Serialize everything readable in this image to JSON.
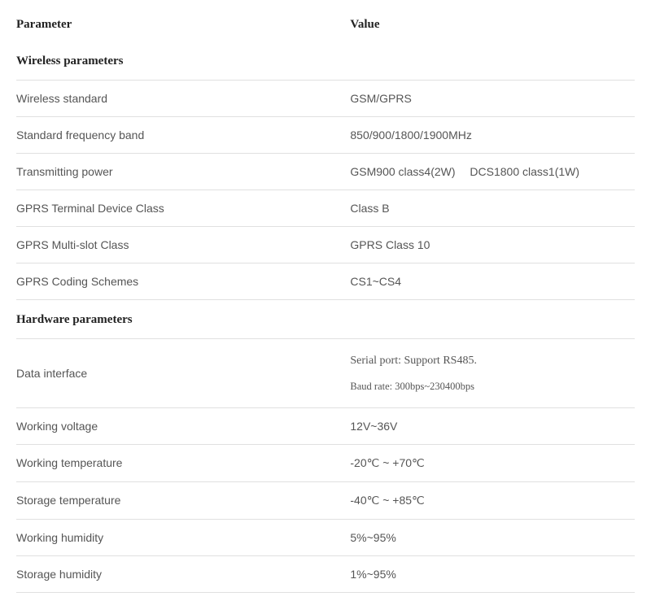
{
  "headers": {
    "parameter": "Parameter",
    "value": "Value"
  },
  "sections": {
    "wireless": "Wireless parameters",
    "hardware": "Hardware parameters"
  },
  "wireless": {
    "standard": {
      "label": "Wireless standard",
      "value": "GSM/GPRS"
    },
    "freq": {
      "label": "Standard frequency band",
      "value": "850/900/1800/1900MHz"
    },
    "txpower": {
      "label": "Transmitting power",
      "value": "GSM900 class4(2W)  DCS1800 class1(1W)"
    },
    "terminal": {
      "label": "GPRS Terminal Device Class",
      "value": "Class B"
    },
    "multislot": {
      "label": "GPRS Multi-slot Class",
      "value": "GPRS Class 10"
    },
    "coding": {
      "label": "GPRS Coding Schemes",
      "value": "CS1~CS4"
    }
  },
  "hardware": {
    "data_interface": {
      "label": "Data interface",
      "line1": "Serial port: Support RS485.",
      "line2": "Baud rate: 300bps~230400bps"
    },
    "voltage": {
      "label": "Working voltage",
      "value": "12V~36V"
    },
    "work_temp": {
      "label": "Working temperature",
      "value": "-20℃ ~ +70℃"
    },
    "storage_temp": {
      "label": "Storage temperature",
      "value": "-40℃ ~ +85℃"
    },
    "work_humidity": {
      "label": "Working humidity",
      "value": "5%~95%"
    },
    "storage_humidity": {
      "label": "Storage humidity",
      "value": "1%~95%"
    }
  }
}
